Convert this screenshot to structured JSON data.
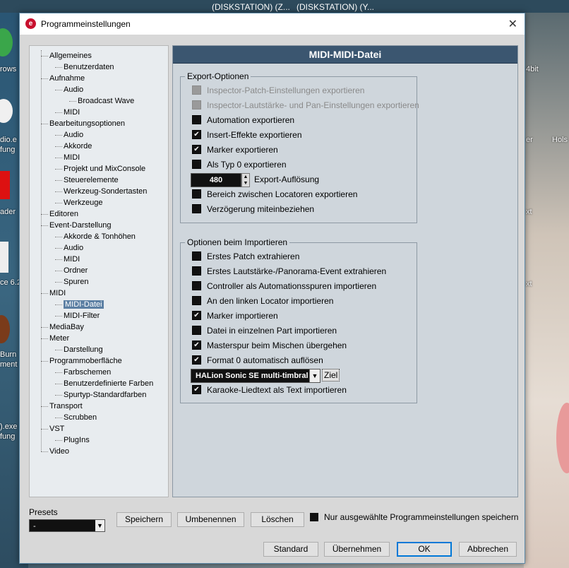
{
  "desktop": {
    "top_labels": [
      "(DISKSTATION) (Z...",
      "(DISKSTATION) (Y..."
    ],
    "left_labels": [
      "rows",
      "dio.e",
      "fung",
      "ader",
      "ce 6.2",
      "Burn",
      "ment",
      ").exe",
      "fung"
    ],
    "right_labels": [
      "4bit",
      "er",
      "Hols",
      "xt",
      "xt"
    ]
  },
  "window": {
    "title": "Programmeinstellungen",
    "app_icon": "cubase-logo-icon",
    "close_glyph": "✕"
  },
  "tree": {
    "items": [
      {
        "label": "Allgemeines",
        "level": 0
      },
      {
        "label": "Benutzerdaten",
        "level": 1
      },
      {
        "label": "Aufnahme",
        "level": 0
      },
      {
        "label": "Audio",
        "level": 1
      },
      {
        "label": "Broadcast Wave",
        "level": 2
      },
      {
        "label": "MIDI",
        "level": 1
      },
      {
        "label": "Bearbeitungsoptionen",
        "level": 0
      },
      {
        "label": "Audio",
        "level": 1
      },
      {
        "label": "Akkorde",
        "level": 1
      },
      {
        "label": "MIDI",
        "level": 1
      },
      {
        "label": "Projekt und MixConsole",
        "level": 1
      },
      {
        "label": "Steuerelemente",
        "level": 1
      },
      {
        "label": "Werkzeug-Sondertasten",
        "level": 1
      },
      {
        "label": "Werkzeuge",
        "level": 1
      },
      {
        "label": "Editoren",
        "level": 0
      },
      {
        "label": "Event-Darstellung",
        "level": 0
      },
      {
        "label": "Akkorde & Tonhöhen",
        "level": 1
      },
      {
        "label": "Audio",
        "level": 1
      },
      {
        "label": "MIDI",
        "level": 1
      },
      {
        "label": "Ordner",
        "level": 1
      },
      {
        "label": "Spuren",
        "level": 1
      },
      {
        "label": "MIDI",
        "level": 0
      },
      {
        "label": "MIDI-Datei",
        "level": 1,
        "selected": true
      },
      {
        "label": "MIDI-Filter",
        "level": 1
      },
      {
        "label": "MediaBay",
        "level": 0
      },
      {
        "label": "Meter",
        "level": 0
      },
      {
        "label": "Darstellung",
        "level": 1
      },
      {
        "label": "Programmoberfläche",
        "level": 0
      },
      {
        "label": "Farbschemen",
        "level": 1
      },
      {
        "label": "Benutzerdefinierte Farben",
        "level": 1
      },
      {
        "label": "Spurtyp-Standardfarben",
        "level": 1
      },
      {
        "label": "Transport",
        "level": 0
      },
      {
        "label": "Scrubben",
        "level": 1
      },
      {
        "label": "VST",
        "level": 0
      },
      {
        "label": "PlugIns",
        "level": 1
      },
      {
        "label": "Video",
        "level": 0
      }
    ]
  },
  "panel": {
    "header": "MIDI-MIDI-Datei",
    "export_group": {
      "title": "Export-Optionen",
      "options": [
        {
          "label": "Inspector-Patch-Einstellungen exportieren",
          "checked": false,
          "disabled": true
        },
        {
          "label": "Inspector-Lautstärke- und Pan-Einstellungen exportieren",
          "checked": false,
          "disabled": true
        },
        {
          "label": "Automation exportieren",
          "checked": false,
          "disabled": false
        },
        {
          "label": "Insert-Effekte exportieren",
          "checked": true,
          "disabled": false
        },
        {
          "label": "Marker exportieren",
          "checked": true,
          "disabled": false
        },
        {
          "label": "Als Typ 0 exportieren",
          "checked": false,
          "disabled": false
        }
      ],
      "resolution_value": "480",
      "resolution_label": "Export-Auflösung",
      "options_after": [
        {
          "label": "Bereich zwischen Locatoren exportieren",
          "checked": false
        },
        {
          "label": "Verzögerung miteinbeziehen",
          "checked": false
        }
      ]
    },
    "import_group": {
      "title": "Optionen beim Importieren",
      "options": [
        {
          "label": "Erstes Patch extrahieren",
          "checked": false
        },
        {
          "label": "Erstes Lautstärke-/Panorama-Event extrahieren",
          "checked": false
        },
        {
          "label": "Controller als Automationsspuren importieren",
          "checked": false
        },
        {
          "label": "An den linken Locator importieren",
          "checked": false
        },
        {
          "label": "Marker importieren",
          "checked": true
        },
        {
          "label": "Datei in einzelnen Part importieren",
          "checked": false
        },
        {
          "label": "Masterspur beim Mischen übergehen",
          "checked": true
        },
        {
          "label": "Format 0 automatisch auflösen",
          "checked": true
        }
      ],
      "instrument_select": "HALion Sonic SE multi-timbral",
      "target_button": "Ziel",
      "options_after": [
        {
          "label": "Karaoke-Liedtext als Text importieren",
          "checked": true
        }
      ]
    }
  },
  "footer": {
    "presets_label": "Presets",
    "presets_value": "-",
    "save": "Speichern",
    "rename": "Umbenennen",
    "delete": "Löschen",
    "only_selected_label": "Nur ausgewählte Programmeinstellungen speichern",
    "standard": "Standard",
    "apply": "Übernehmen",
    "ok": "OK",
    "cancel": "Abbrechen"
  }
}
